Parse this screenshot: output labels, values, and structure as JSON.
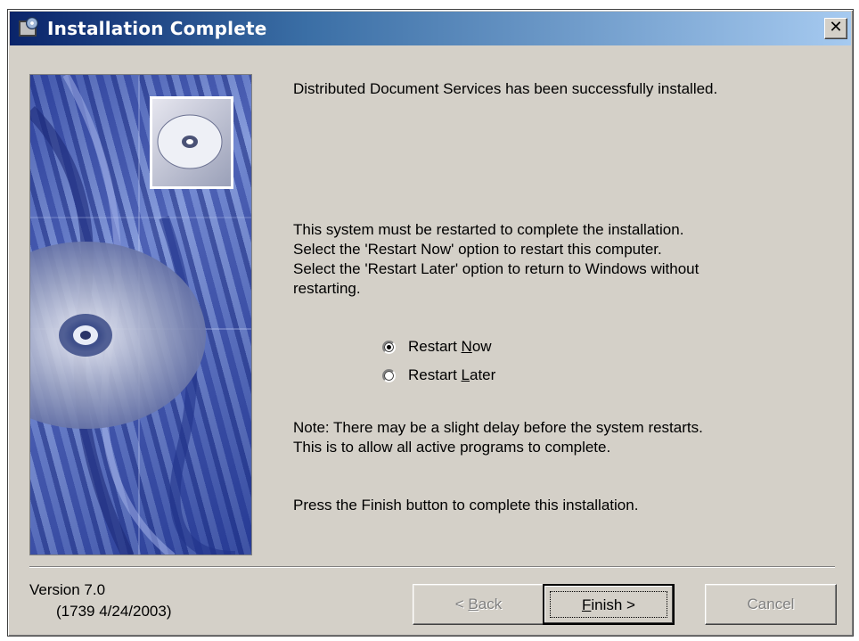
{
  "window": {
    "title": "Installation Complete",
    "close_label": "✕"
  },
  "content": {
    "success_message": "Distributed Document Services has been successfully installed.",
    "restart_lines": [
      "This system must be restarted to complete the installation.",
      "Select the 'Restart Now' option to restart this computer.",
      "Select the 'Restart Later' option to return to Windows without",
      "restarting."
    ],
    "note_lines": [
      "Note:  There may be a slight delay before the system restarts.",
      "This is to allow all active programs to complete."
    ],
    "press_message": "Press the Finish button to complete this installation."
  },
  "options": {
    "restart_now": {
      "prefix": "Restart ",
      "accel": "N",
      "suffix": "ow",
      "selected": true
    },
    "restart_later": {
      "prefix": "Restart ",
      "accel": "L",
      "suffix": "ater",
      "selected": false
    }
  },
  "footer": {
    "version": "Version 7.0",
    "build": "(1739  4/24/2003)"
  },
  "buttons": {
    "back": {
      "prefix": "< ",
      "accel": "B",
      "suffix": "ack",
      "enabled": false
    },
    "finish": {
      "prefix": "",
      "accel": "F",
      "suffix": "inish >",
      "enabled": true
    },
    "cancel": {
      "label": "Cancel",
      "enabled": false
    }
  },
  "colors": {
    "titlebar_start": "#0a246a",
    "titlebar_end": "#a6caf0",
    "dialog_face": "#d4d0c8"
  }
}
